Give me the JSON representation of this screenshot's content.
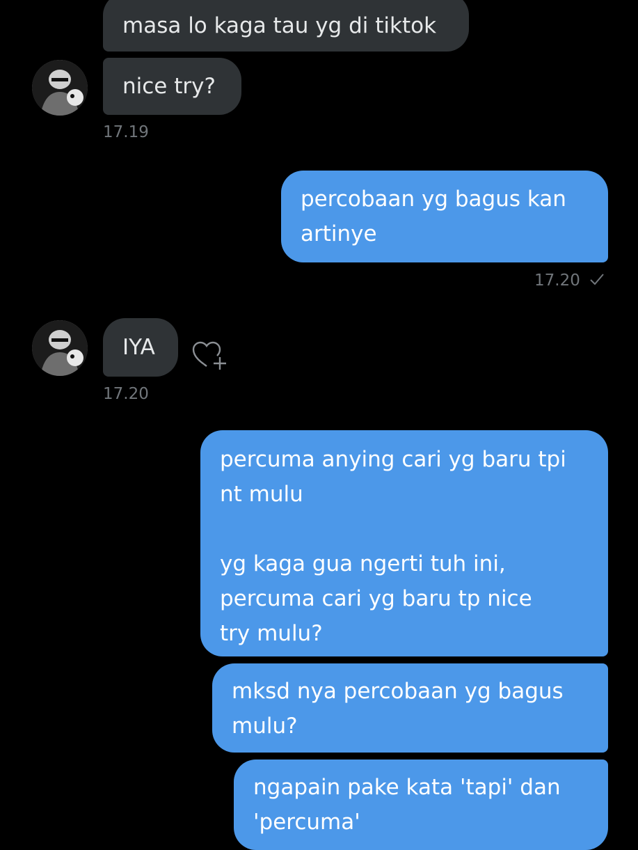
{
  "colors": {
    "background": "#000000",
    "received_bubble": "#2f3336",
    "sent_bubble": "#4c98e9",
    "timestamp": "#71767b"
  },
  "conversation": {
    "group1": {
      "messages": [
        "masa lo kaga tau yg di tiktok",
        "nice try?"
      ],
      "time": "17.19",
      "avatar_icon": "contact-avatar"
    },
    "group2": {
      "messages": [
        "percobaan yg bagus kan\nartinye"
      ],
      "time": "17.20",
      "status_icon": "checkmark-icon"
    },
    "group3": {
      "messages": [
        "IYA"
      ],
      "time": "17.20",
      "reaction_icon": "heart-plus-icon"
    },
    "group4": {
      "messages": [
        "percuma anying cari yg baru tpi\nnt mulu\n\nyg kaga gua ngerti tuh ini,\npercuma cari yg baru tp nice\ntry mulu?",
        "mksd nya percobaan yg bagus\nmulu?",
        "ngapain pake kata 'tapi' dan\n'percuma'"
      ]
    }
  }
}
